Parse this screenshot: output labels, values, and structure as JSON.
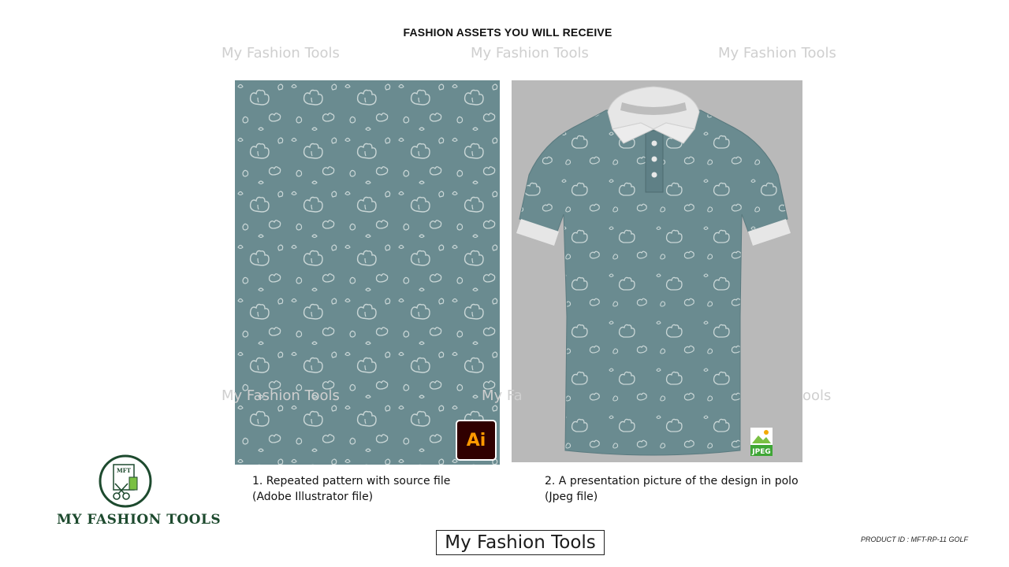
{
  "header": {
    "title": "FASHION ASSETS YOU WILL RECEIVE"
  },
  "watermark": {
    "text": "My Fashion Tools",
    "partial_left": "My Fa",
    "partial_right": "ools"
  },
  "assets": [
    {
      "caption_line1": "1. Repeated pattern with source file",
      "caption_line2": "(Adobe Illustrator file)",
      "badge": "Ai"
    },
    {
      "caption_line1": "2. A presentation picture of the design in polo",
      "caption_line2": "(Jpeg file)",
      "badge": "JPEG"
    }
  ],
  "brand": {
    "name": "MY FASHION TOOLS",
    "logo_initials": "MFT",
    "box_text": "My Fashion Tools"
  },
  "product_id": "PRODUCT ID : MFT-RP-11 GOLF",
  "colors": {
    "pattern_bg": "#6a8b90",
    "motif": "#c9d6d6",
    "polo_bg": "#b9b9b9",
    "collar": "#e6e6e6",
    "brand_green": "#1d4a2e",
    "ai_bg": "#300000",
    "ai_fg": "#ff9a00"
  }
}
